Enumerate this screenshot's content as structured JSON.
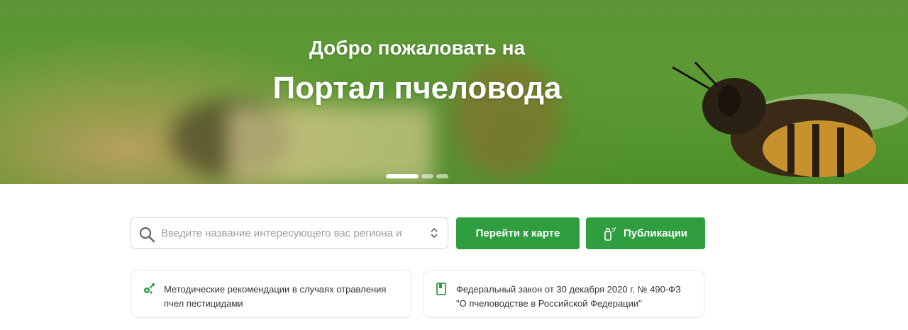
{
  "hero": {
    "subtitle": "Добро пожаловать на",
    "title": "Портал пчеловода",
    "slides": 3,
    "active_slide": 1
  },
  "search": {
    "placeholder": "Введите название интересующего вас региона и"
  },
  "buttons": {
    "map_label": "Перейти к карте",
    "publications_label": "Публикации"
  },
  "cards": [
    {
      "icon": "pesticide-icon",
      "text": "Методические рекомендации в случаях отравления пчел пестицидами"
    },
    {
      "icon": "document-icon",
      "text": "Федеральный закон от 30 декабря 2020 г. № 490-ФЗ \"О пчеловодстве в Российской Федерации\""
    }
  ],
  "colors": {
    "accent": "#2e9e3e",
    "hero_green": "#5b9a33"
  }
}
